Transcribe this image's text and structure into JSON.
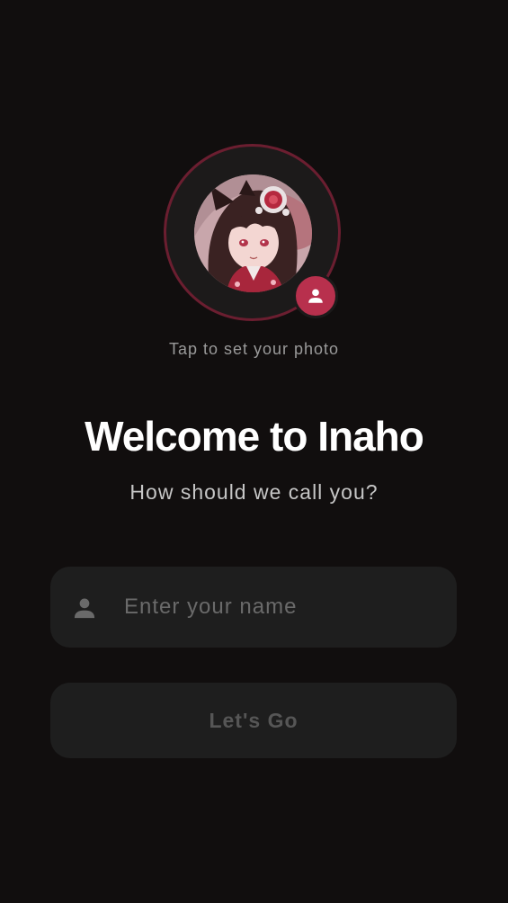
{
  "avatar": {
    "photo": "anime-girl-portrait",
    "badge_icon": "person-icon",
    "ring_color": "#6b1e30",
    "badge_color": "#b8304d",
    "hint": "Tap to set your photo"
  },
  "welcome": {
    "title": "Welcome to Inaho",
    "subtitle": "How should we call you?"
  },
  "name_field": {
    "icon": "person-icon",
    "value": "",
    "placeholder": "Enter your name"
  },
  "actions": {
    "submit_label": "Let's Go"
  },
  "colors": {
    "background": "#110e0e",
    "surface": "#1e1e1e",
    "accent": "#b8304d"
  }
}
